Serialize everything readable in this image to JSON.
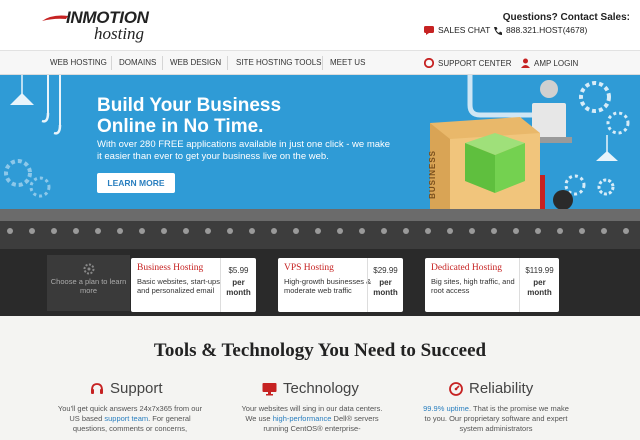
{
  "header": {
    "logo_main": "INMOTION",
    "logo_sub": "hosting",
    "contact_title": "Questions? Contact Sales:",
    "sales_chat": "SALES CHAT",
    "phone": "888.321.HOST(4678)"
  },
  "nav": {
    "items": [
      "WEB HOSTING",
      "DOMAINS",
      "WEB DESIGN",
      "SITE HOSTING TOOLS",
      "MEET US"
    ],
    "support": "SUPPORT CENTER",
    "amp": "AMP LOGIN"
  },
  "hero": {
    "title": "Build Your Business Online in No Time.",
    "desc": "With over 280 FREE applications available in just one click - we make it easier than ever to get your business live on the web.",
    "cta": "LEARN MORE",
    "box_label": "BUSINESS"
  },
  "plans": {
    "choose": "Choose a plan to learn more",
    "items": [
      {
        "name": "Business Hosting",
        "desc": "Basic websites, start-ups and personalized email",
        "price": "$5.99",
        "per": "per",
        "period": "month"
      },
      {
        "name": "VPS Hosting",
        "desc": "High-growth businesses & moderate web traffic",
        "price": "$29.99",
        "per": "per",
        "period": "month"
      },
      {
        "name": "Dedicated Hosting",
        "desc": "Big sites, high traffic, and root access",
        "price": "$119.99",
        "per": "per",
        "period": "month"
      }
    ]
  },
  "features": {
    "title": "Tools & Technology You Need to Succeed",
    "items": [
      {
        "title": "Support",
        "text_a": "You'll get quick answers 24x7x365 from our US based ",
        "link": "support team",
        "text_b": ". For general questions, comments or concerns,"
      },
      {
        "title": "Technology",
        "text_a": "Your websites will sing in our data centers. We use ",
        "link": "high-performance",
        "text_b": " Dell® servers running CentOS® enterprise-"
      },
      {
        "title": "Reliability",
        "text_a": "",
        "link": "99.9% uptime",
        "text_b": ". That is the promise we make to you. Our proprietary software and expert system administrators"
      }
    ]
  },
  "colors": {
    "accent_red": "#c62222",
    "hero_blue": "#2f9bd6",
    "link_blue": "#2a7fbf"
  }
}
